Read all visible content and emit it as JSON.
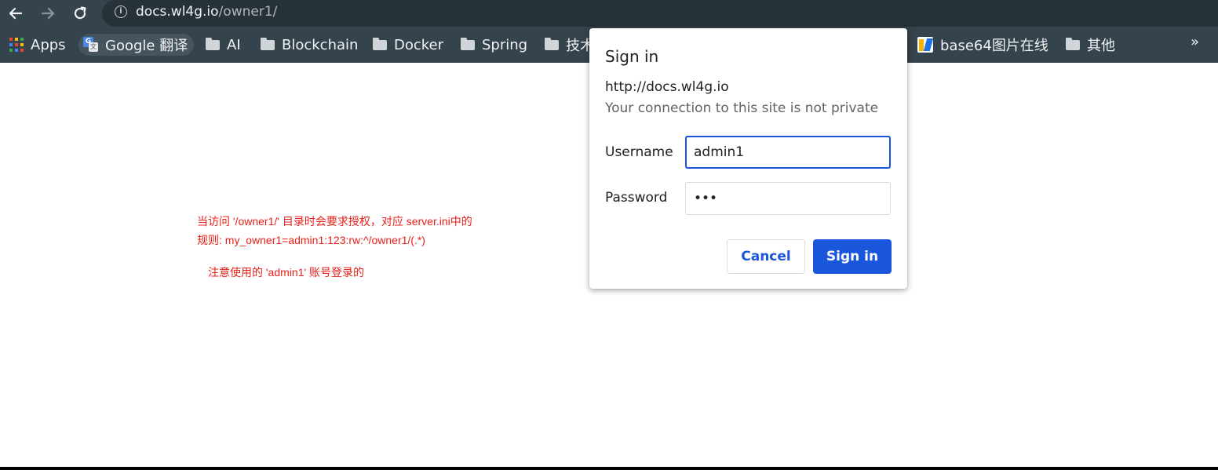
{
  "browser": {
    "url_host": "docs.wl4g.io",
    "url_path": "/owner1/"
  },
  "bookmarks": [
    {
      "label": "Apps",
      "icon": "apps-grid-icon"
    },
    {
      "label": "Google 翻译",
      "icon": "google-translate-icon"
    },
    {
      "label": "AI",
      "icon": "folder-icon"
    },
    {
      "label": "Blockchain",
      "icon": "folder-icon"
    },
    {
      "label": "Docker",
      "icon": "folder-icon"
    },
    {
      "label": "Spring",
      "icon": "folder-icon"
    },
    {
      "label": "技术",
      "icon": "folder-icon"
    },
    {
      "label": "base64图片在线",
      "icon": "base64-site-icon"
    },
    {
      "label": "其他",
      "icon": "folder-icon"
    }
  ],
  "bookmarks_overflow": "»",
  "annotation": {
    "line1": "当访问 '/owner1/' 目录时会要求授权，对应 server.ini中的",
    "line2": "规则: my_owner1=admin1:123:rw:^/owner1/(.*)",
    "line3": "注意使用的 'admin1' 账号登录的",
    "color": "#e8201a"
  },
  "dialog": {
    "title": "Sign in",
    "origin": "http://docs.wl4g.io",
    "warning": "Your connection to this site is not private",
    "username_label": "Username",
    "username_value": "admin1",
    "password_label": "Password",
    "password_value": "•••",
    "cancel_label": "Cancel",
    "signin_label": "Sign in",
    "accent_color": "#1a56db"
  }
}
